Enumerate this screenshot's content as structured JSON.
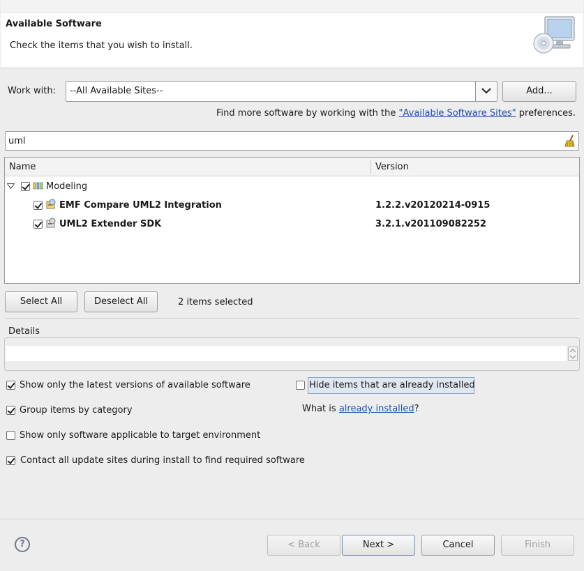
{
  "banner": {
    "title": "Available Software",
    "description": "Check the items that you wish to install."
  },
  "work_with": {
    "label": "Work with:",
    "value": "--All Available Sites--",
    "add_label": "Add..."
  },
  "find_more": {
    "prefix": "Find more software by working with the ",
    "link": "\"Available Software Sites\"",
    "suffix": " preferences."
  },
  "filter": {
    "value": "uml"
  },
  "tree": {
    "columns": [
      "Name",
      "Version"
    ],
    "category": {
      "name": "Modeling",
      "checked": true,
      "expanded": true
    },
    "items": [
      {
        "name": "EMF Compare UML2 Integration",
        "version": "1.2.2.v20120214-0915",
        "checked": true
      },
      {
        "name": "UML2 Extender SDK",
        "version": "3.2.1.v201109082252",
        "checked": true
      }
    ]
  },
  "selection": {
    "select_all": "Select All",
    "deselect_all": "Deselect All",
    "count_text": "2 items selected"
  },
  "details": {
    "label": "Details",
    "text": ""
  },
  "options": {
    "latest_versions": {
      "label": "Show only the latest versions of available software",
      "checked": true
    },
    "hide_installed": {
      "label": "Hide items that are already installed",
      "checked": false
    },
    "group_by_category": {
      "label": "Group items by category",
      "checked": true
    },
    "what_is_prefix": "What is ",
    "what_is_link": "already installed",
    "what_is_suffix": "?",
    "target_env": {
      "label": "Show only software applicable to target environment",
      "checked": false
    },
    "contact_sites": {
      "label": "Contact all update sites during install to find required software",
      "checked": true
    }
  },
  "footer": {
    "back": "< Back",
    "next": "Next >",
    "cancel": "Cancel",
    "finish": "Finish",
    "help": "?"
  }
}
